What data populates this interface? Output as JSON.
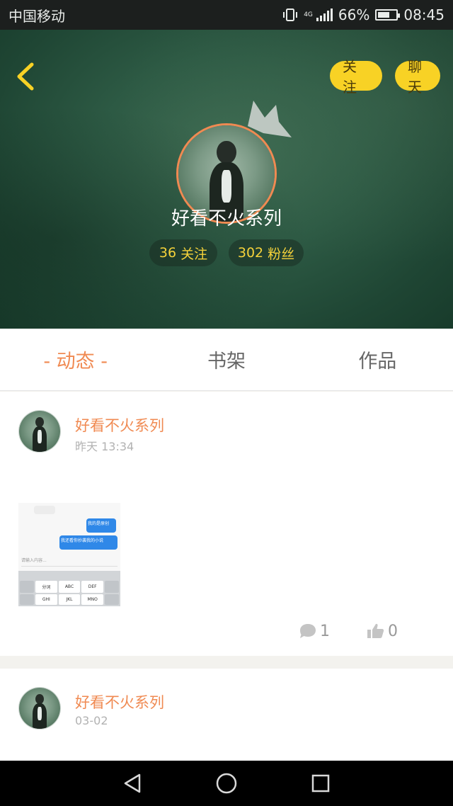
{
  "status_bar": {
    "carrier": "中国移动",
    "network": "4G",
    "battery": "66%",
    "time": "08:45"
  },
  "profile": {
    "name": "好看不火系列",
    "follow_label": "关注",
    "chat_label": "聊天",
    "following_count": "36",
    "following_label": "关注",
    "fans_count": "302",
    "fans_label": "粉丝"
  },
  "tabs": [
    {
      "label": "- 动态 -",
      "active": true
    },
    {
      "label": "书架",
      "active": false
    },
    {
      "label": "作品",
      "active": false
    }
  ],
  "posts": [
    {
      "author": "好看不火系列",
      "time": "昨天 13:34",
      "thumbnail": {
        "bubble_1": "我的是原创",
        "bubble_2": "我还看你抄袭我的小说",
        "input_placeholder": "请输入内容...",
        "keys": [
          "分词",
          "ABC",
          "DEF",
          "GHI",
          "JKL",
          "MNO"
        ]
      },
      "comments": "1",
      "likes": "0"
    },
    {
      "author": "好看不火系列",
      "time": "03-02"
    }
  ],
  "icons": {
    "back": "chevron-left-icon",
    "crown": "crown-icon",
    "comment": "comment-bubble-icon",
    "like": "thumbs-up-icon",
    "nav_back": "triangle-back-icon",
    "nav_home": "circle-home-icon",
    "nav_recent": "square-recent-icon"
  },
  "colors": {
    "accent": "#f08a52",
    "button_yellow": "#f8d225",
    "stat_text": "#f5d23a",
    "header_green": "#2d5a44"
  }
}
